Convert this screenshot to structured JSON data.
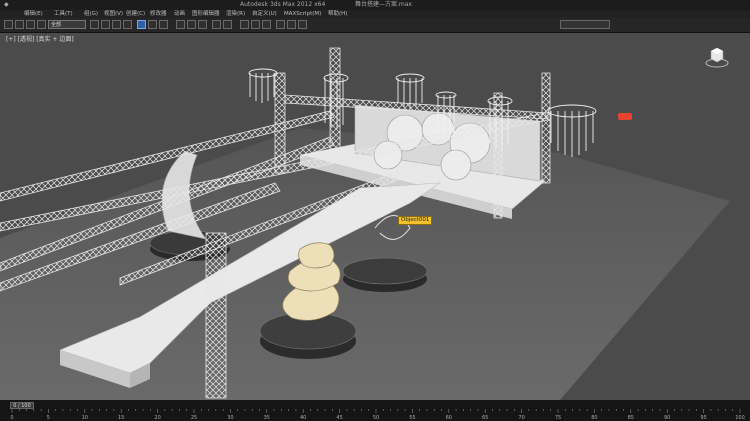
{
  "titlebar": {
    "app_title": "Autodesk 3ds Max 2012 x64",
    "file_title": "舞台搭建—方案.max"
  },
  "menu": [
    "编辑(E)",
    "工具(T)",
    "组(G)",
    "视图(V)",
    "创建(C)",
    "修改器",
    "动画",
    "图形编辑器",
    "渲染(R)",
    "自定义(U)",
    "MAXScript(M)",
    "帮助(H)"
  ],
  "toolbar": {
    "selection_set": "全部"
  },
  "viewport": {
    "label": "[+] [透视] [真实 + 边面]",
    "object_label": "Object001",
    "scene": "stage truss structure with chandeliers, circular platforms and T-shaped runway"
  },
  "timeline": {
    "frame_display": "0 / 100",
    "ticks": [
      "0",
      "5",
      "10",
      "15",
      "20",
      "25",
      "30",
      "35",
      "40",
      "45",
      "50",
      "55",
      "60",
      "65",
      "70",
      "75",
      "80",
      "85",
      "90",
      "95",
      "100"
    ]
  },
  "colors": {
    "viewport_bg": "#4b4b4b",
    "floor": "#646464",
    "truss": "#e6e6e6",
    "label_bg": "#f2c22c",
    "marker": "#e8432e"
  },
  "icons": [
    "undo-icon",
    "redo-icon",
    "link-icon",
    "unlink-icon",
    "bind-icon",
    "select-icon",
    "select-by-name-icon",
    "rect-region-icon",
    "window-crossing-icon",
    "move-icon",
    "rotate-icon",
    "scale-icon",
    "snap-icon",
    "angle-snap-icon",
    "percent-snap-icon",
    "mirror-icon",
    "align-icon",
    "layer-icon",
    "curve-editor-icon",
    "schematic-icon",
    "material-editor-icon",
    "render-setup-icon",
    "render-icon",
    "viewcube-icon"
  ]
}
